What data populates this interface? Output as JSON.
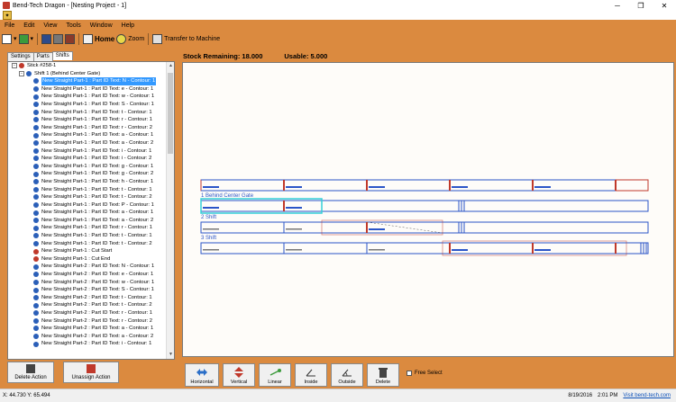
{
  "window": {
    "title": "Bend-Tech Dragon - [Nesting Project - 1]"
  },
  "menu": [
    "File",
    "Edit",
    "View",
    "Tools",
    "Window",
    "Help"
  ],
  "toolbar": {
    "home": "Home",
    "zoom": "Zoom",
    "transfer": "Transfer to Machine"
  },
  "left": {
    "tabs": [
      "Settings",
      "Parts",
      "Shifts"
    ],
    "active_tab": "Shifts",
    "tree": [
      {
        "label": "Stick #258-1",
        "level": 0,
        "icon": "stick",
        "expander": "-"
      },
      {
        "label": "Shift 1 (Behind Center Gate)",
        "level": 1,
        "icon": "shift",
        "expander": "-"
      },
      {
        "label": "New Straight Part-1 : Part ID Text: N - Contour: 1",
        "level": 2,
        "icon": "contour",
        "selected": true
      },
      {
        "label": "New Straight Part-1 : Part ID Text: e - Contour: 1",
        "level": 2,
        "icon": "contour"
      },
      {
        "label": "New Straight Part-1 : Part ID Text: w - Contour: 1",
        "level": 2,
        "icon": "contour"
      },
      {
        "label": "New Straight Part-1 : Part ID Text: S - Contour: 1",
        "level": 2,
        "icon": "contour"
      },
      {
        "label": "New Straight Part-1 : Part ID Text: t - Contour: 1",
        "level": 2,
        "icon": "contour"
      },
      {
        "label": "New Straight Part-1 : Part ID Text: r - Contour: 1",
        "level": 2,
        "icon": "contour"
      },
      {
        "label": "New Straight Part-1 : Part ID Text: r - Contour: 2",
        "level": 2,
        "icon": "contour"
      },
      {
        "label": "New Straight Part-1 : Part ID Text: a - Contour: 1",
        "level": 2,
        "icon": "contour"
      },
      {
        "label": "New Straight Part-1 : Part ID Text: a - Contour: 2",
        "level": 2,
        "icon": "contour"
      },
      {
        "label": "New Straight Part-1 : Part ID Text: i - Contour: 1",
        "level": 2,
        "icon": "contour"
      },
      {
        "label": "New Straight Part-1 : Part ID Text: i - Contour: 2",
        "level": 2,
        "icon": "contour"
      },
      {
        "label": "New Straight Part-1 : Part ID Text: g - Contour: 1",
        "level": 2,
        "icon": "contour"
      },
      {
        "label": "New Straight Part-1 : Part ID Text: g - Contour: 2",
        "level": 2,
        "icon": "contour"
      },
      {
        "label": "New Straight Part-1 : Part ID Text: h - Contour: 1",
        "level": 2,
        "icon": "contour"
      },
      {
        "label": "New Straight Part-1 : Part ID Text: t - Contour: 1",
        "level": 2,
        "icon": "contour"
      },
      {
        "label": "New Straight Part-1 : Part ID Text: t - Contour: 2",
        "level": 2,
        "icon": "contour"
      },
      {
        "label": "New Straight Part-1 : Part ID Text: P - Contour: 1",
        "level": 2,
        "icon": "contour"
      },
      {
        "label": "New Straight Part-1 : Part ID Text: a - Contour: 1",
        "level": 2,
        "icon": "contour"
      },
      {
        "label": "New Straight Part-1 : Part ID Text: a - Contour: 2",
        "level": 2,
        "icon": "contour"
      },
      {
        "label": "New Straight Part-1 : Part ID Text: r - Contour: 1",
        "level": 2,
        "icon": "contour"
      },
      {
        "label": "New Straight Part-1 : Part ID Text: t - Contour: 1",
        "level": 2,
        "icon": "contour"
      },
      {
        "label": "New Straight Part-1 : Part ID Text: t - Contour: 2",
        "level": 2,
        "icon": "contour"
      },
      {
        "label": "New Straight Part-1 : Cut Start",
        "level": 2,
        "icon": "cut-start"
      },
      {
        "label": "New Straight Part-1 : Cut End",
        "level": 2,
        "icon": "cut-end"
      },
      {
        "label": "New Straight Part-2 : Part ID Text: N - Contour: 1",
        "level": 2,
        "icon": "contour"
      },
      {
        "label": "New Straight Part-2 : Part ID Text: e - Contour: 1",
        "level": 2,
        "icon": "contour"
      },
      {
        "label": "New Straight Part-2 : Part ID Text: w - Contour: 1",
        "level": 2,
        "icon": "contour"
      },
      {
        "label": "New Straight Part-2 : Part ID Text: S - Contour: 1",
        "level": 2,
        "icon": "contour"
      },
      {
        "label": "New Straight Part-2 : Part ID Text: t - Contour: 1",
        "level": 2,
        "icon": "contour"
      },
      {
        "label": "New Straight Part-2 : Part ID Text: t - Contour: 2",
        "level": 2,
        "icon": "contour"
      },
      {
        "label": "New Straight Part-2 : Part ID Text: r - Contour: 1",
        "level": 2,
        "icon": "contour"
      },
      {
        "label": "New Straight Part-2 : Part ID Text: r - Contour: 2",
        "level": 2,
        "icon": "contour"
      },
      {
        "label": "New Straight Part-2 : Part ID Text: a - Contour: 1",
        "level": 2,
        "icon": "contour"
      },
      {
        "label": "New Straight Part-2 : Part ID Text: a - Contour: 2",
        "level": 2,
        "icon": "contour"
      },
      {
        "label": "New Straight Part-2 : Part ID Text: i - Contour: 1",
        "level": 2,
        "icon": "contour"
      }
    ],
    "delete_action": "Delete Action",
    "unassign_action": "Unassign Action"
  },
  "stock": {
    "remaining": "Stock Remaining: 18.000",
    "usable": "Usable: 5.000"
  },
  "canvas": {
    "shift_labels": [
      "1 Behind Center Gate",
      "2 Shift",
      "3 Shift"
    ]
  },
  "actions": [
    "Horizontal",
    "Vertical",
    "Linear",
    "Inside",
    "Outside",
    "Delete"
  ],
  "free_select": "Free Select",
  "status": {
    "coords": "X: 44.730  Y: 65.494",
    "date": "8/19/2016",
    "time": "2:01 PM",
    "link": "Visit bend-tech.com"
  },
  "colors": {
    "panel": "#db8a3f",
    "select": "#3399ff",
    "blue_line": "#2b55c8",
    "red_line": "#c0392b",
    "cyan_box": "#35d0d8"
  }
}
